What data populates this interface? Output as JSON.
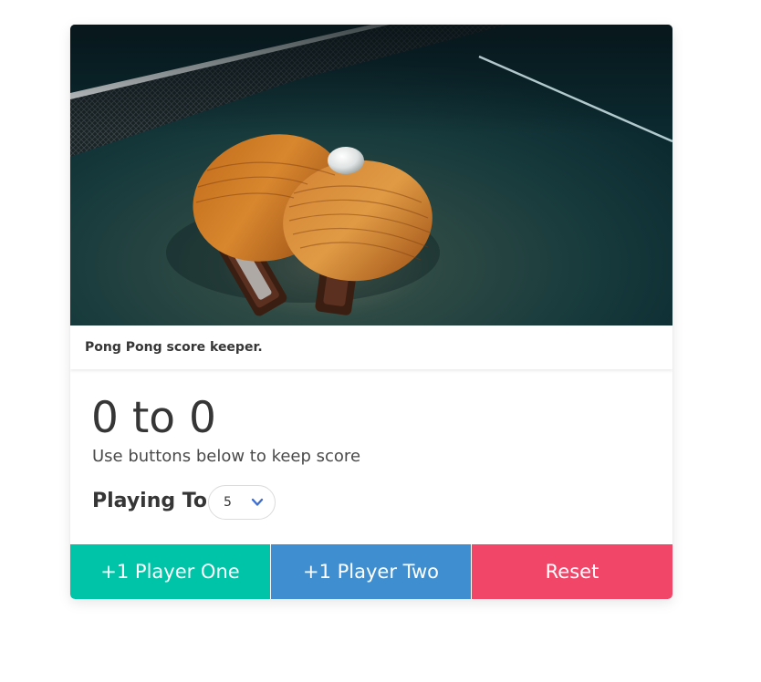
{
  "figure": {
    "caption": "Pong Pong score keeper."
  },
  "score": {
    "text": "0 to 0",
    "player_one": 0,
    "player_two": 0
  },
  "instructions": "Use buttons below to keep score",
  "playing_to": {
    "label": "Playing To:",
    "selected": "5"
  },
  "buttons": {
    "player_one": "+1 Player One",
    "player_two": "+1 Player Two",
    "reset": "Reset"
  },
  "colors": {
    "player_one": "#00c4a7",
    "player_two": "#3e8ed0",
    "reset": "#f14668"
  }
}
